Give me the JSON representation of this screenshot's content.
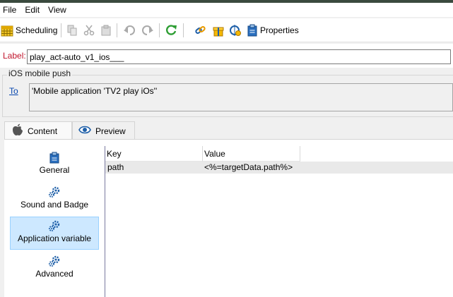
{
  "menu": {
    "file": "File",
    "edit": "Edit",
    "view": "View"
  },
  "toolbar": {
    "scheduling_label": "Scheduling",
    "properties_label": "Properties"
  },
  "form": {
    "label_caption": "Label:",
    "label_value": "play_act-auto_v1_ios___",
    "group_title": "iOS mobile push",
    "to_link": "To",
    "to_value": "'Mobile application 'TV2 play iOs''"
  },
  "tabs": [
    {
      "label": "Content",
      "icon": "apple-icon"
    },
    {
      "label": "Preview",
      "icon": "eye-icon"
    }
  ],
  "sidenav": [
    {
      "label": "General",
      "icon": "clipboard-icon"
    },
    {
      "label": "Sound and Badge",
      "icon": "gears-icon"
    },
    {
      "label": "Application variable",
      "icon": "gears-icon",
      "selected": true
    },
    {
      "label": "Advanced",
      "icon": "gears-icon"
    }
  ],
  "grid": {
    "columns": [
      "Key",
      "Value"
    ],
    "rows": [
      {
        "key": "path",
        "value": "<%=targetData.path%>"
      }
    ]
  },
  "colors": {
    "label_caption": "#c0142b",
    "link": "#0645ad",
    "selected_bg": "#cde8ff",
    "accent_green": "#2e9e34",
    "accent_blue": "#1e5fa8"
  }
}
